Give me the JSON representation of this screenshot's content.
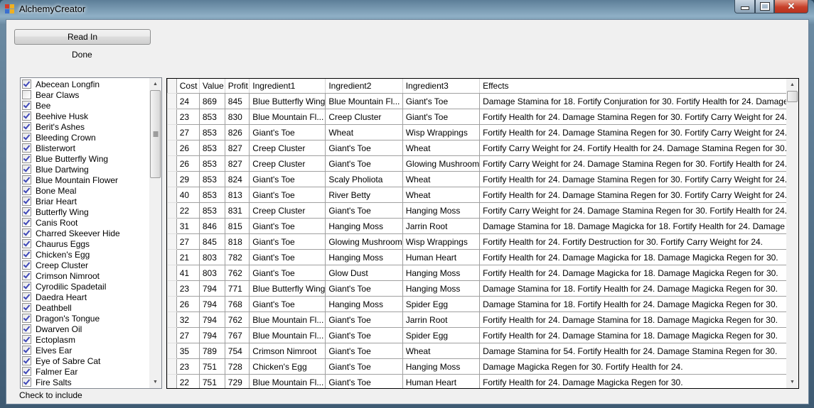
{
  "window": {
    "title": "AlchemyCreator",
    "icon": "app-window-icon",
    "controls": {
      "minimize": "minimize-icon",
      "maximize": "maximize-icon",
      "close": "close-icon"
    }
  },
  "toolbar": {
    "read_in_label": "Read In",
    "status": "Done"
  },
  "ingredients": {
    "hint": "Check to include",
    "items": [
      {
        "label": "Abecean Longfin",
        "checked": true
      },
      {
        "label": "Bear Claws",
        "checked": false
      },
      {
        "label": "Bee",
        "checked": true
      },
      {
        "label": "Beehive Husk",
        "checked": true
      },
      {
        "label": "Berit's Ashes",
        "checked": true
      },
      {
        "label": "Bleeding Crown",
        "checked": true
      },
      {
        "label": "Blisterwort",
        "checked": true
      },
      {
        "label": "Blue Butterfly Wing",
        "checked": true
      },
      {
        "label": "Blue Dartwing",
        "checked": true
      },
      {
        "label": "Blue Mountain Flower",
        "checked": true
      },
      {
        "label": "Bone Meal",
        "checked": true
      },
      {
        "label": "Briar Heart",
        "checked": true
      },
      {
        "label": "Butterfly Wing",
        "checked": true
      },
      {
        "label": "Canis Root",
        "checked": true
      },
      {
        "label": "Charred Skeever Hide",
        "checked": true
      },
      {
        "label": "Chaurus Eggs",
        "checked": true
      },
      {
        "label": "Chicken's Egg",
        "checked": true
      },
      {
        "label": "Creep Cluster",
        "checked": true
      },
      {
        "label": "Crimson Nimroot",
        "checked": true
      },
      {
        "label": "Cyrodilic Spadetail",
        "checked": true
      },
      {
        "label": "Daedra Heart",
        "checked": true
      },
      {
        "label": "Deathbell",
        "checked": true
      },
      {
        "label": "Dragon's Tongue",
        "checked": true
      },
      {
        "label": "Dwarven Oil",
        "checked": true
      },
      {
        "label": "Ectoplasm",
        "checked": true
      },
      {
        "label": "Elves Ear",
        "checked": true
      },
      {
        "label": "Eye of Sabre Cat",
        "checked": true
      },
      {
        "label": "Falmer Ear",
        "checked": true
      },
      {
        "label": "Fire Salts",
        "checked": true
      }
    ]
  },
  "results": {
    "columns": [
      "Cost",
      "Value",
      "Profit",
      "Ingredient1",
      "Ingredient2",
      "Ingredient3",
      "Effects"
    ],
    "rows": [
      [
        "24",
        "869",
        "845",
        "Blue Butterfly Wing",
        "Blue Mountain Fl...",
        "Giant's Toe",
        "Damage Stamina for 18. Fortify Conjuration for 30. Fortify Health for 24. Damage ..."
      ],
      [
        "23",
        "853",
        "830",
        "Blue Mountain Fl...",
        "Creep Cluster",
        "Giant's Toe",
        "Fortify Health for 24. Damage Stamina Regen for 30. Fortify Carry Weight for 24."
      ],
      [
        "27",
        "853",
        "826",
        "Giant's Toe",
        "Wheat",
        "Wisp Wrappings",
        "Fortify Health for 24. Damage Stamina Regen for 30. Fortify Carry Weight for 24."
      ],
      [
        "26",
        "853",
        "827",
        "Creep Cluster",
        "Giant's Toe",
        "Wheat",
        "Fortify Carry Weight for 24. Fortify Health for 24. Damage Stamina Regen for 30."
      ],
      [
        "26",
        "853",
        "827",
        "Creep Cluster",
        "Giant's Toe",
        "Glowing Mushroom",
        "Fortify Carry Weight for 24. Damage Stamina Regen for 30. Fortify Health for 24."
      ],
      [
        "29",
        "853",
        "824",
        "Giant's Toe",
        "Scaly Pholiota",
        "Wheat",
        "Fortify Health for 24. Damage Stamina Regen for 30. Fortify Carry Weight for 24."
      ],
      [
        "40",
        "853",
        "813",
        "Giant's Toe",
        "River Betty",
        "Wheat",
        "Fortify Health for 24. Damage Stamina Regen for 30. Fortify Carry Weight for 24."
      ],
      [
        "22",
        "853",
        "831",
        "Creep Cluster",
        "Giant's Toe",
        "Hanging Moss",
        "Fortify Carry Weight for 24. Damage Stamina Regen for 30. Fortify Health for 24."
      ],
      [
        "31",
        "846",
        "815",
        "Giant's Toe",
        "Hanging Moss",
        "Jarrin Root",
        "Damage Stamina for 18. Damage Magicka for 18. Fortify Health for 24. Damage ..."
      ],
      [
        "27",
        "845",
        "818",
        "Giant's Toe",
        "Glowing Mushroom",
        "Wisp Wrappings",
        "Fortify Health for 24. Fortify Destruction for 30. Fortify Carry Weight for 24."
      ],
      [
        "21",
        "803",
        "782",
        "Giant's Toe",
        "Hanging Moss",
        "Human Heart",
        "Fortify Health for 24. Damage Magicka for 18. Damage Magicka Regen for 30."
      ],
      [
        "41",
        "803",
        "762",
        "Giant's Toe",
        "Glow Dust",
        "Hanging Moss",
        "Fortify Health for 24. Damage Magicka for 18. Damage Magicka Regen for 30."
      ],
      [
        "23",
        "794",
        "771",
        "Blue Butterfly Wing",
        "Giant's Toe",
        "Hanging Moss",
        "Damage Stamina for 18. Fortify Health for 24. Damage Magicka Regen for 30."
      ],
      [
        "26",
        "794",
        "768",
        "Giant's Toe",
        "Hanging Moss",
        "Spider Egg",
        "Damage Stamina for 18. Fortify Health for 24. Damage Magicka Regen for 30."
      ],
      [
        "32",
        "794",
        "762",
        "Blue Mountain Fl...",
        "Giant's Toe",
        "Jarrin Root",
        "Fortify Health for 24. Damage Stamina for 18. Damage Magicka Regen for 30."
      ],
      [
        "27",
        "794",
        "767",
        "Blue Mountain Fl...",
        "Giant's Toe",
        "Spider Egg",
        "Fortify Health for 24. Damage Stamina for 18. Damage Magicka Regen for 30."
      ],
      [
        "35",
        "789",
        "754",
        "Crimson Nimroot",
        "Giant's Toe",
        "Wheat",
        "Damage Stamina for 54. Fortify Health for 24. Damage Stamina Regen for 30."
      ],
      [
        "23",
        "751",
        "728",
        "Chicken's Egg",
        "Giant's Toe",
        "Hanging Moss",
        "Damage Magicka Regen for 30. Fortify Health for 24."
      ],
      [
        "22",
        "751",
        "729",
        "Blue Mountain Fl...",
        "Giant's Toe",
        "Human Heart",
        "Fortify Health for 24. Damage Magicka Regen for 30."
      ]
    ]
  }
}
